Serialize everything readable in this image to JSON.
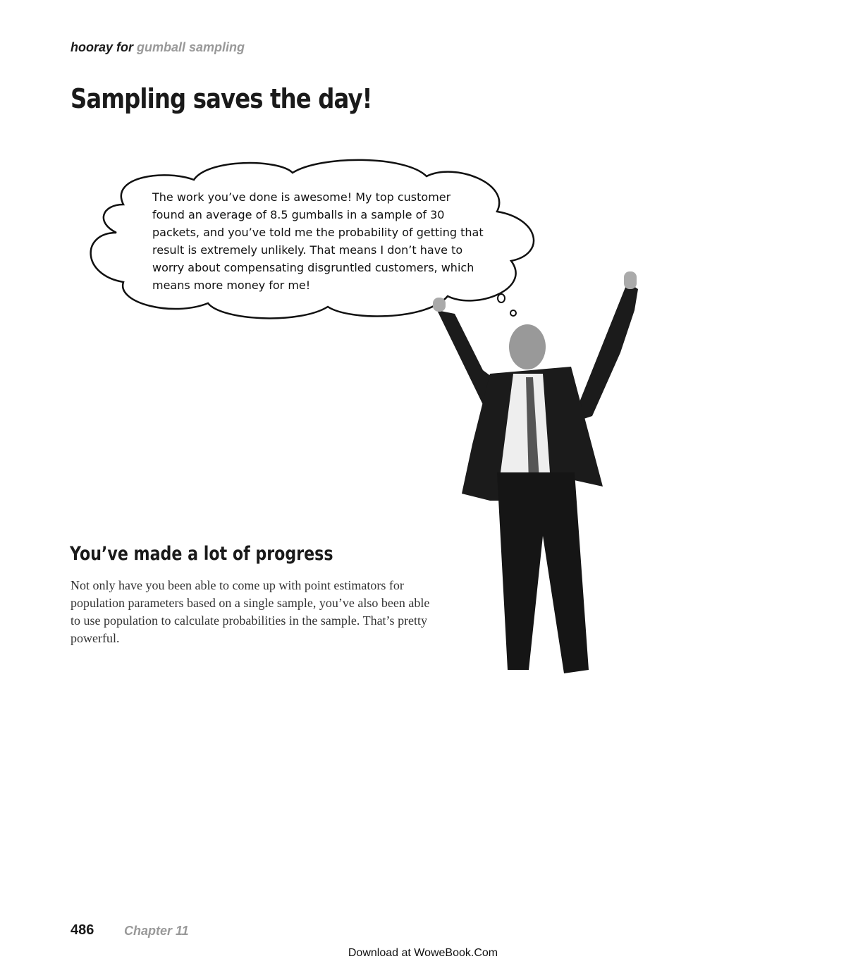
{
  "header": {
    "prefix": "hooray for",
    "section": "gumball sampling"
  },
  "title": "Sampling saves the day!",
  "thought_bubble": "The work you’ve done is awesome! My top customer found an average of 8.5 gumballs in a sample of 30 packets, and you’ve told me the probability of getting that result is extremely unlikely. That means I don’t have to worry about compensating disgruntled customers, which means more money for me!",
  "subheading": "You’ve made a lot of progress",
  "body": "Not only have you been able to come up with point estimators for population parameters based on a single sample, you’ve also been able to use population to calculate probabilities in the sample. That’s pretty powerful.",
  "footer": {
    "page_number": "486",
    "chapter": "Chapter 11",
    "download": "Download at WoweBook.Com"
  }
}
